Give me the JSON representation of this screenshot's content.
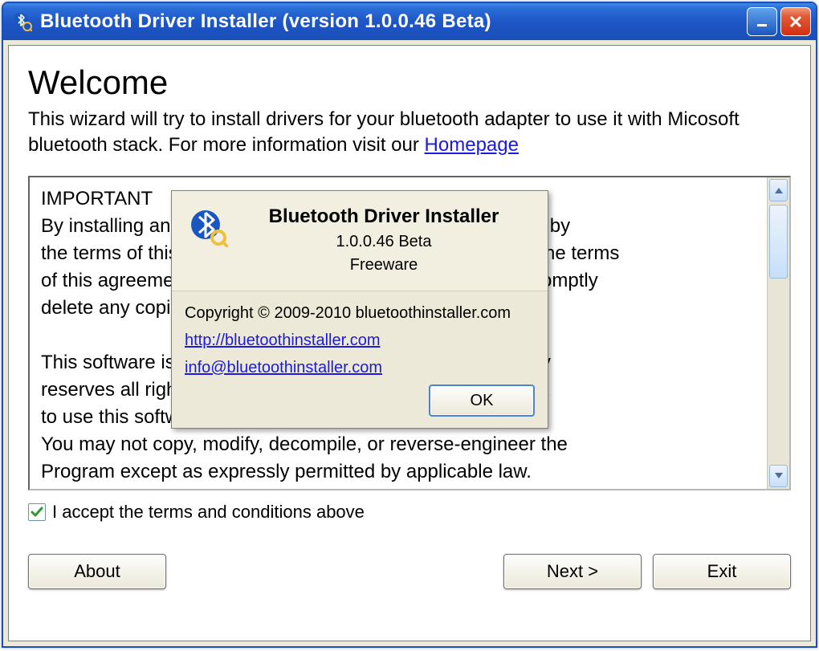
{
  "window": {
    "title": "Bluetooth Driver Installer (version 1.0.0.46 Beta)"
  },
  "welcome": {
    "heading": "Welcome",
    "intro_pre": "This wizard will try to install drivers for your bluetooth adapter to use it with Micosoft bluetooth stack.   For more information visit our ",
    "homepage_label": "Homepage"
  },
  "license": {
    "text": "IMPORTANT\nBy installing and using this software you agree to be bound by\nthe terms of this license agreement. If you do not agree to the terms\nof this agreement, do not install or use this software and promptly\ndelete any copies of it in your possession.\n\nThis software is freeware. bluetoothinstaller.com exclusively\nreserves all rights to this software. You are granted the right\nto  use this software for personal and commercial purposes.\nYou may not copy, modify, decompile, or reverse-engineer the\nProgram except as expressly permitted by applicable law."
  },
  "accept": {
    "label": "I accept the terms and conditions above",
    "checked": true
  },
  "buttons": {
    "about": "About",
    "next": "Next >",
    "exit": "Exit"
  },
  "about": {
    "title": "Bluetooth Driver Installer",
    "version": "1.0.0.46 Beta",
    "license_type": "Freeware",
    "copyright": "Copyright © 2009-2010 bluetoothinstaller.com",
    "url": "http://bluetoothinstaller.com",
    "email": "info@bluetoothinstaller.com",
    "ok": "OK"
  }
}
